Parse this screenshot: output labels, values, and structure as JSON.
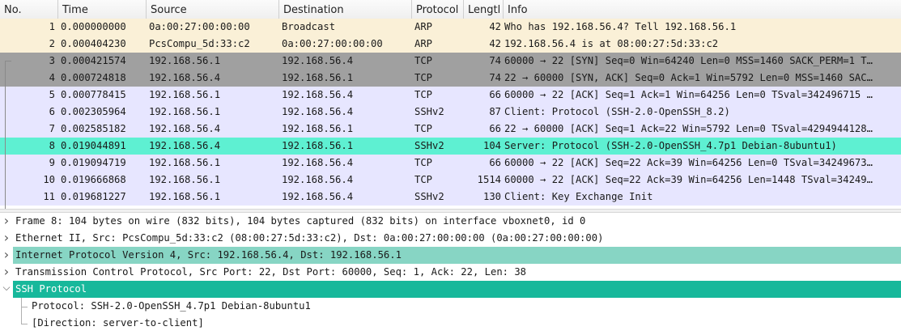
{
  "columns": [
    "No.",
    "Time",
    "Source",
    "Destination",
    "Protocol",
    "Lengtl",
    "Info"
  ],
  "colors": {
    "arp": "#faf0d7",
    "tcp_syn": "#a0a0a0",
    "tcp": "#e7e6ff",
    "ssh_selected": "#5ef0d2",
    "tree_highlight": "#87d5c4",
    "tree_selected": "#17b89b"
  },
  "packets": [
    {
      "no": "1",
      "time": "0.000000000",
      "src": "0a:00:27:00:00:00",
      "dst": "Broadcast",
      "proto": "ARP",
      "len": "42",
      "info": "Who has 192.168.56.4? Tell 192.168.56.1",
      "color": "arp"
    },
    {
      "no": "2",
      "time": "0.000404230",
      "src": "PcsCompu_5d:33:c2",
      "dst": "0a:00:27:00:00:00",
      "proto": "ARP",
      "len": "42",
      "info": "192.168.56.4 is at 08:00:27:5d:33:c2",
      "color": "arp"
    },
    {
      "no": "3",
      "time": "0.000421574",
      "src": "192.168.56.1",
      "dst": "192.168.56.4",
      "proto": "TCP",
      "len": "74",
      "info": "60000 → 22 [SYN] Seq=0 Win=64240 Len=0 MSS=1460 SACK_PERM=1 T…",
      "color": "tcp_syn"
    },
    {
      "no": "4",
      "time": "0.000724818",
      "src": "192.168.56.4",
      "dst": "192.168.56.1",
      "proto": "TCP",
      "len": "74",
      "info": "22 → 60000 [SYN, ACK] Seq=0 Ack=1 Win=5792 Len=0 MSS=1460 SAC…",
      "color": "tcp_syn"
    },
    {
      "no": "5",
      "time": "0.000778415",
      "src": "192.168.56.1",
      "dst": "192.168.56.4",
      "proto": "TCP",
      "len": "66",
      "info": "60000 → 22 [ACK] Seq=1 Ack=1 Win=64256 Len=0 TSval=342496715 …",
      "color": "tcp"
    },
    {
      "no": "6",
      "time": "0.002305964",
      "src": "192.168.56.1",
      "dst": "192.168.56.4",
      "proto": "SSHv2",
      "len": "87",
      "info": "Client: Protocol (SSH-2.0-OpenSSH_8.2)",
      "color": "tcp"
    },
    {
      "no": "7",
      "time": "0.002585182",
      "src": "192.168.56.4",
      "dst": "192.168.56.1",
      "proto": "TCP",
      "len": "66",
      "info": "22 → 60000 [ACK] Seq=1 Ack=22 Win=5792 Len=0 TSval=4294944128…",
      "color": "tcp"
    },
    {
      "no": "8",
      "time": "0.019044891",
      "src": "192.168.56.4",
      "dst": "192.168.56.1",
      "proto": "SSHv2",
      "len": "104",
      "info": "Server: Protocol (SSH-2.0-OpenSSH_4.7p1 Debian-8ubuntu1)",
      "color": "ssh_selected"
    },
    {
      "no": "9",
      "time": "0.019094719",
      "src": "192.168.56.1",
      "dst": "192.168.56.4",
      "proto": "TCP",
      "len": "66",
      "info": "60000 → 22 [ACK] Seq=22 Ack=39 Win=64256 Len=0 TSval=34249673…",
      "color": "tcp"
    },
    {
      "no": "10",
      "time": "0.019666868",
      "src": "192.168.56.1",
      "dst": "192.168.56.4",
      "proto": "TCP",
      "len": "1514",
      "info": "60000 → 22 [ACK] Seq=22 Ack=39 Win=64256 Len=1448 TSval=34249…",
      "color": "tcp"
    },
    {
      "no": "11",
      "time": "0.019681227",
      "src": "192.168.56.1",
      "dst": "192.168.56.4",
      "proto": "SSHv2",
      "len": "130",
      "info": "Client: Key Exchange Init",
      "color": "tcp"
    }
  ],
  "details": [
    {
      "text": "Frame 8: 104 bytes on wire (832 bits), 104 bytes captured (832 bits) on interface vboxnet0, id 0",
      "expander": "collapsed",
      "state": "normal"
    },
    {
      "text": "Ethernet II, Src: PcsCompu_5d:33:c2 (08:00:27:5d:33:c2), Dst: 0a:00:27:00:00:00 (0a:00:27:00:00:00)",
      "expander": "collapsed",
      "state": "normal"
    },
    {
      "text": "Internet Protocol Version 4, Src: 192.168.56.4, Dst: 192.168.56.1",
      "expander": "collapsed",
      "state": "highlight"
    },
    {
      "text": "Transmission Control Protocol, Src Port: 22, Dst Port: 60000, Seq: 1, Ack: 22, Len: 38",
      "expander": "collapsed",
      "state": "normal"
    },
    {
      "text": "SSH Protocol",
      "expander": "expanded",
      "state": "selected"
    },
    {
      "text": "Protocol: SSH-2.0-OpenSSH_4.7p1 Debian-8ubuntu1",
      "expander": "none",
      "state": "child"
    },
    {
      "text": "[Direction: server-to-client]",
      "expander": "none",
      "state": "child"
    }
  ]
}
